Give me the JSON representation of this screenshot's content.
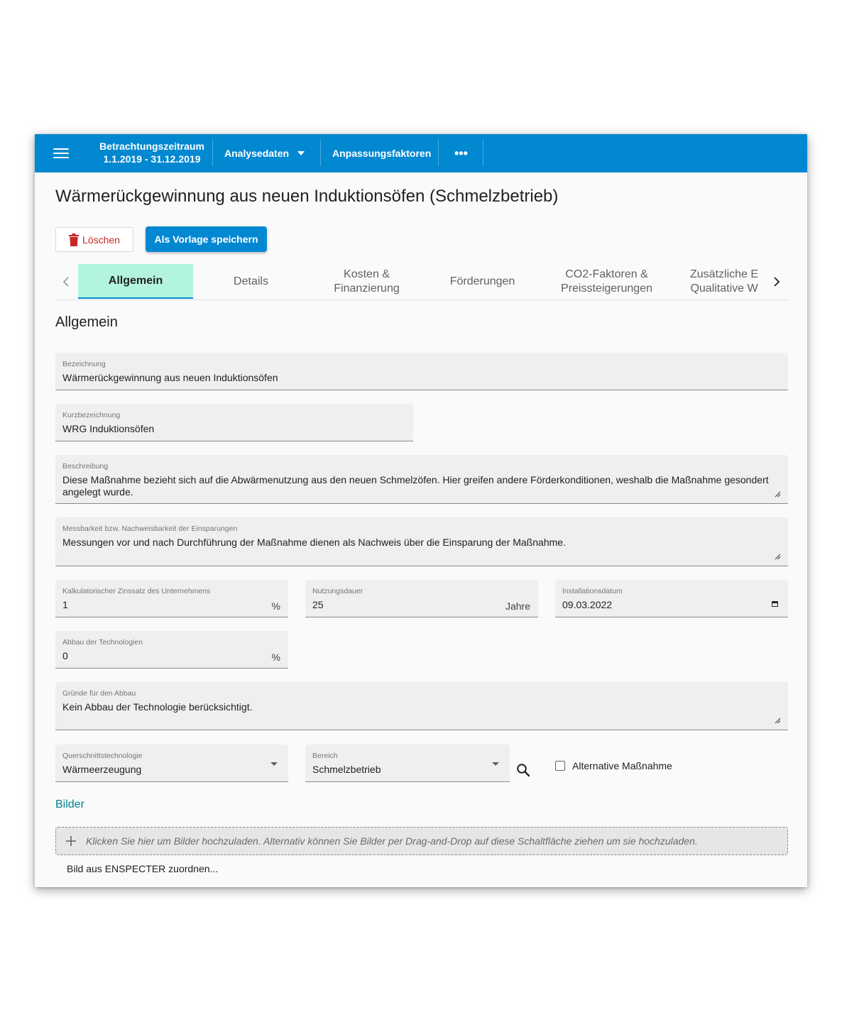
{
  "topbar": {
    "period_label": "Betrachtungszeitraum",
    "period_range": "1.1.2019 - 31.12.2019",
    "analysis": "Analysedaten",
    "adjustment": "Anpassungsfaktoren",
    "more": "•••"
  },
  "page": {
    "title": "Wärmerückgewinnung aus neuen Induktionsöfen (Schmelzbetrieb)",
    "delete_label": "Löschen",
    "save_template_label": "Als Vorlage speichern",
    "section_title": "Allgemein"
  },
  "tabs": [
    {
      "label": "Allgemein",
      "active": true
    },
    {
      "label": "Details"
    },
    {
      "line1": "Kosten &",
      "line2": "Finanzierung"
    },
    {
      "label": "Förderungen"
    },
    {
      "line1": "CO2-Faktoren &",
      "line2": "Preissteigerungen"
    },
    {
      "line1": "Zusätzliche E",
      "line2": "Qualitative W"
    }
  ],
  "fields": {
    "bezeichnung": {
      "label": "Bezeichnung",
      "value": "Wärmerückgewinnung aus neuen Induktionsöfen"
    },
    "kurzbezeichnung": {
      "label": "Kurzbezeichnung",
      "value": "WRG Induktionsöfen"
    },
    "beschreibung": {
      "label": "Beschreibung",
      "value": "Diese Maßnahme bezieht sich auf die Abwärmenutzung aus den neuen Schmelzöfen. Hier greifen andere Förderkonditionen, weshalb die Maßnahme gesondert angelegt wurde."
    },
    "messbarkeit": {
      "label": "Messbarkeit bzw. Nachweisbarkeit der Einsparungen",
      "value": "Messungen vor und nach Durchführung der Maßnahme dienen als Nachweis über die Einsparung der Maßnahme."
    },
    "zinssatz": {
      "label": "Kalkulatorischer Zinssatz des Unternehmens",
      "value": "1",
      "suffix": "%"
    },
    "nutzungsdauer": {
      "label": "Nutzungsdauer",
      "value": "25",
      "suffix": "Jahre"
    },
    "installationsdatum": {
      "label": "Installationsdatum",
      "value": "09.03.2022"
    },
    "abbau": {
      "label": "Abbau der Technologien",
      "value": "0",
      "suffix": "%"
    },
    "gruende": {
      "label": "Gründe für den Abbau",
      "value": "Kein Abbau der Technologie berücksichtigt."
    },
    "querschnitt": {
      "label": "Querschnittstechnologie",
      "value": "Wärmeerzeugung"
    },
    "bereich": {
      "label": "Bereich",
      "value": "Schmelzbetrieb"
    }
  },
  "alternative_label": "Alternative Maßnahme",
  "images": {
    "title": "Bilder",
    "upload_text": "Klicken Sie hier um Bilder hochzuladen. Alternativ können Sie Bilder per Drag-and-Drop auf diese Schaltfläche ziehen um sie hochzuladen.",
    "assign_text": "Bild aus ENSPECTER zuordnen..."
  },
  "colors": {
    "primary": "#0288d1",
    "active_tab": "#b2f5dc",
    "delete": "#c62828",
    "section_link": "#00838f"
  }
}
